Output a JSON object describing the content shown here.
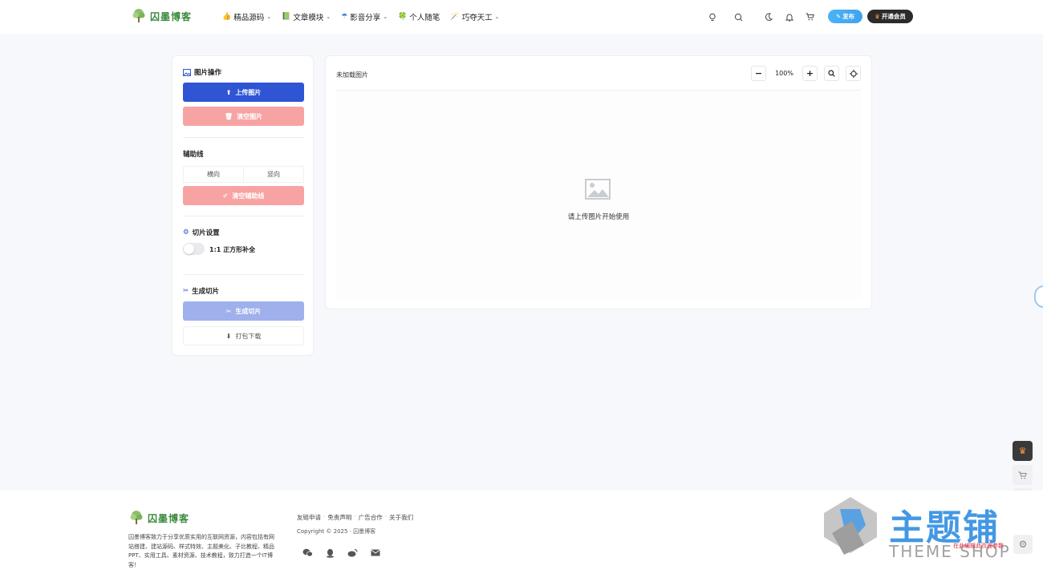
{
  "header": {
    "logo_text": "囚墨博客",
    "nav": [
      {
        "icon": "👍",
        "label": "精品源码",
        "has_dropdown": true
      },
      {
        "icon": "📗",
        "label": "文章模块",
        "has_dropdown": true
      },
      {
        "icon": "☂",
        "label": "影音分享",
        "has_dropdown": true
      },
      {
        "icon": "🍀",
        "label": "个人随笔",
        "has_dropdown": false
      },
      {
        "icon": "🪄",
        "label": "巧夺天工",
        "has_dropdown": true
      }
    ],
    "icons": [
      "lightbulb-icon",
      "search-icon",
      "moon-icon",
      "bell-icon",
      "cart-icon"
    ],
    "publish_label": "发布",
    "vip_label": "开通会员",
    "colors": {
      "publish": "#3fa2ef",
      "vip": "#2b2b2b"
    }
  },
  "panel": {
    "image_ops_title": "图片操作",
    "upload_label": "上传图片",
    "clear_label": "清空图片",
    "guides_title": "辅助线",
    "guide_h": "横向",
    "guide_v": "竖向",
    "clear_guides_label": "清空辅助线",
    "slice_title": "切片设置",
    "square_toggle_label": "1:1 正方形补全",
    "square_toggle_on": false,
    "generate_title": "生成切片",
    "generate_label": "生成切片",
    "download_label": "打包下载",
    "colors": {
      "primary": "#2f55d4",
      "danger_light": "#f7a3a3",
      "primary_light": "#9fb0ec"
    }
  },
  "workspace": {
    "status_text": "未加载图片",
    "zoom_value": "100%",
    "hint_text": "请上传图片开始使用"
  },
  "footer": {
    "logo_text": "囚墨博客",
    "description": "囚墨博客致力于分享优质实用的互联网资源，内容包括有网站搭建、建站源码、样式特效、主题美化、子比教程、精品PPT、实用工具、素材资源、技术教程，致力打造一个IT博客！",
    "links": [
      "友链申请",
      "免责声明",
      "广告合作",
      "关于我们"
    ],
    "copyright": "Copyright © 2025 · 囚墨博客",
    "social_icons": [
      "wechat-icon",
      "qq-icon",
      "weibo-icon",
      "mail-icon"
    ]
  },
  "watermark": {
    "cn_text": "主题铺",
    "en_text": "THEME SHOP",
    "red_text": "在此编辑此页面参数"
  }
}
